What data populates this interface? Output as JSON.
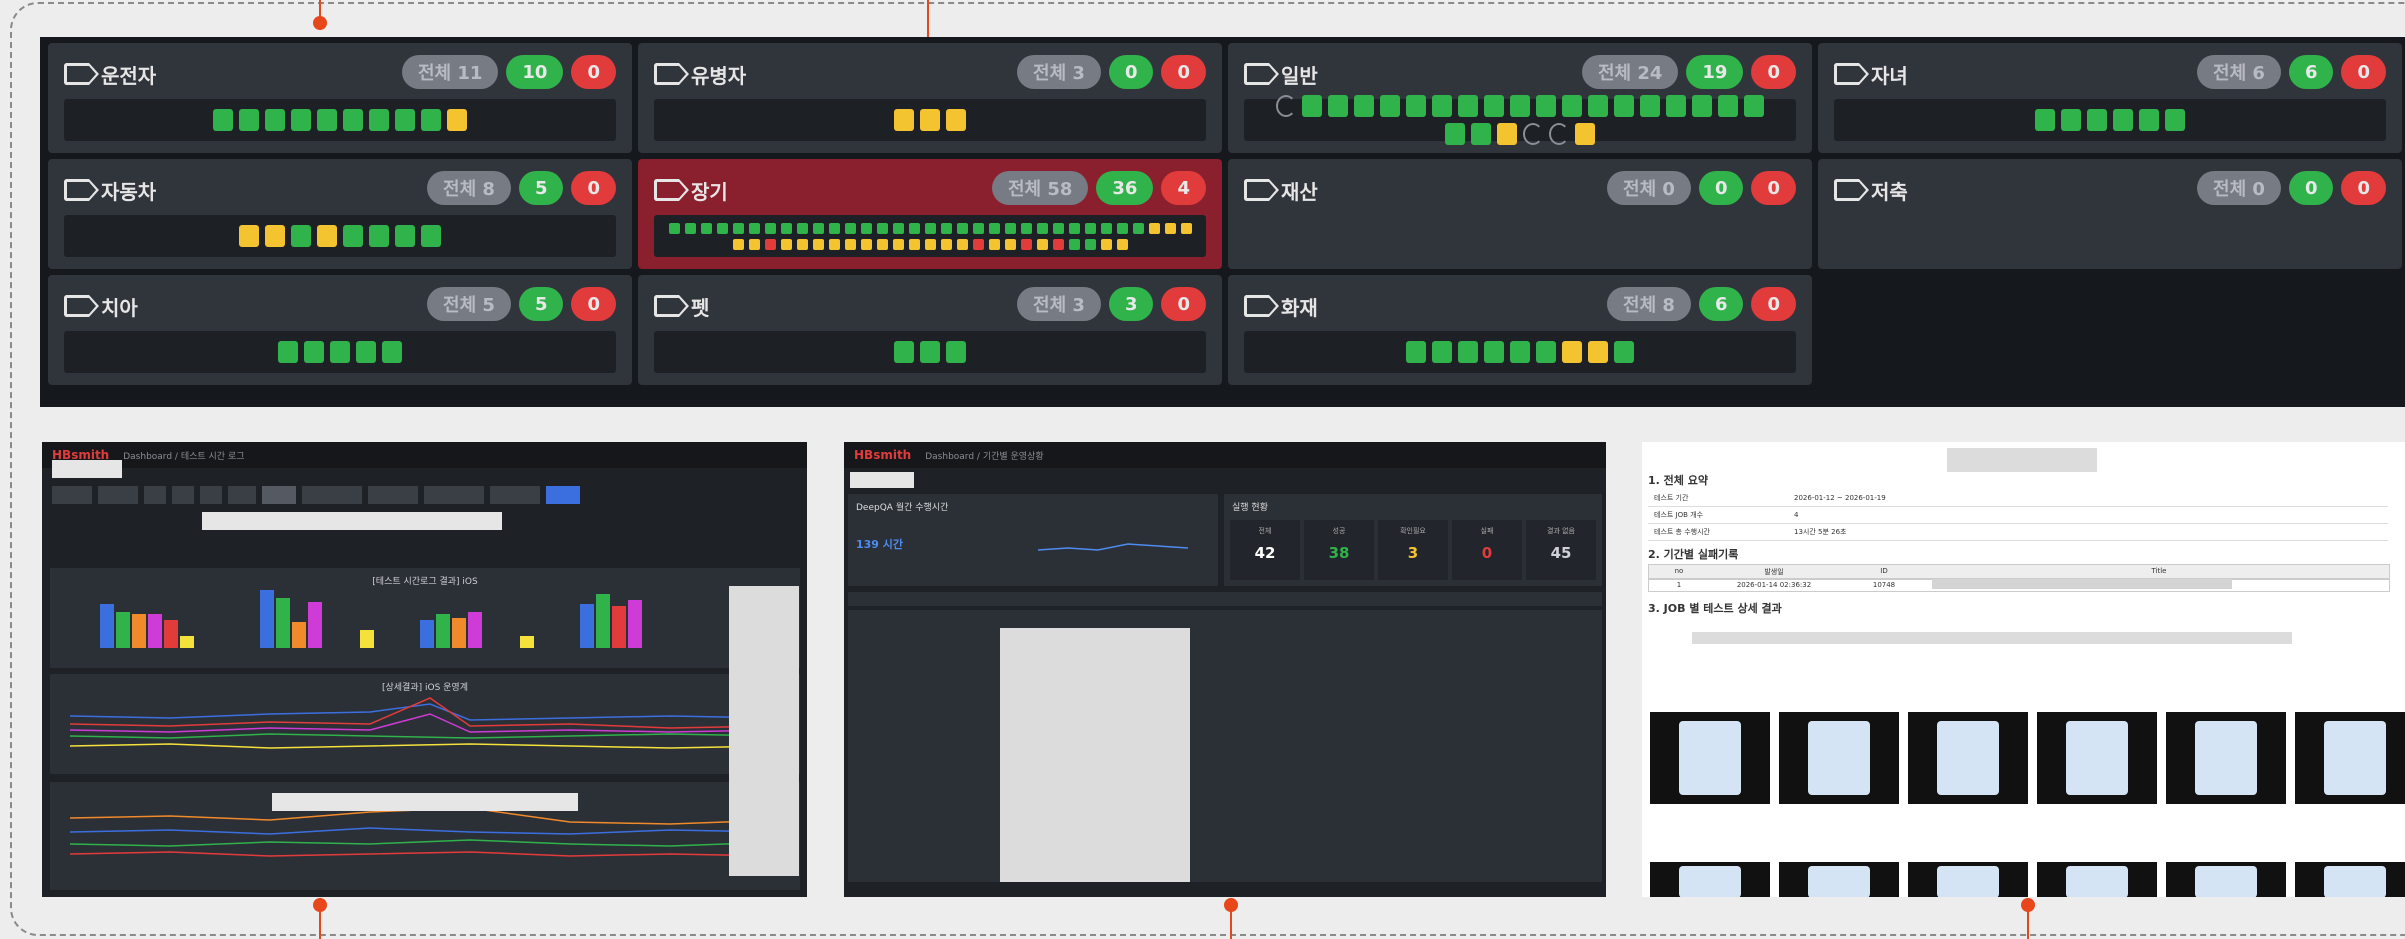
{
  "cards": [
    {
      "name": "운전자",
      "total": "전체 11",
      "pass": "10",
      "fail": "0",
      "red": false,
      "squares": [
        "g",
        "g",
        "g",
        "g",
        "g",
        "g",
        "g",
        "g",
        "g",
        "y"
      ]
    },
    {
      "name": "유병자",
      "total": "전체 3",
      "pass": "0",
      "fail": "0",
      "red": false,
      "squares": [
        "y",
        "y",
        "y"
      ]
    },
    {
      "name": "일반",
      "total": "전체 24",
      "pass": "19",
      "fail": "0",
      "red": false,
      "squares": [
        "o",
        "g",
        "g",
        "g",
        "g",
        "g",
        "g",
        "g",
        "g",
        "g",
        "g",
        "g",
        "g",
        "g",
        "g",
        "g",
        "g",
        "g",
        "g",
        "g",
        "g",
        "y",
        "o",
        "o",
        "y"
      ]
    },
    {
      "name": "자녀",
      "total": "전체 6",
      "pass": "6",
      "fail": "0",
      "red": false,
      "squares": [
        "g",
        "g",
        "g",
        "g",
        "g",
        "g"
      ]
    },
    {
      "name": "자동차",
      "total": "전체 8",
      "pass": "5",
      "fail": "0",
      "red": false,
      "squares": [
        "y",
        "y",
        "g",
        "y",
        "g",
        "g",
        "g",
        "g"
      ]
    },
    {
      "name": "장기",
      "total": "전체 58",
      "pass": "36",
      "fail": "4",
      "red": true,
      "squares": [
        "g",
        "g",
        "g",
        "g",
        "g",
        "g",
        "g",
        "g",
        "g",
        "g",
        "g",
        "g",
        "g",
        "g",
        "g",
        "g",
        "g",
        "g",
        "g",
        "g",
        "g",
        "g",
        "g",
        "g",
        "g",
        "g",
        "g",
        "g",
        "g",
        "g",
        "y",
        "y",
        "y",
        "y",
        "y",
        "r",
        "y",
        "y",
        "y",
        "y",
        "y",
        "y",
        "y",
        "y",
        "y",
        "y",
        "y",
        "y",
        "r",
        "y",
        "y",
        "r",
        "y",
        "r",
        "g",
        "g",
        "y",
        "y"
      ]
    },
    {
      "name": "재산",
      "total": "전체 0",
      "pass": "0",
      "fail": "0",
      "red": false,
      "squares": []
    },
    {
      "name": "저축",
      "total": "전체 0",
      "pass": "0",
      "fail": "0",
      "red": false,
      "squares": []
    },
    {
      "name": "치아",
      "total": "전체 5",
      "pass": "5",
      "fail": "0",
      "red": false,
      "squares": [
        "g",
        "g",
        "g",
        "g",
        "g"
      ]
    },
    {
      "name": "펫",
      "total": "전체 3",
      "pass": "3",
      "fail": "0",
      "red": false,
      "squares": [
        "g",
        "g",
        "g"
      ]
    },
    {
      "name": "화재",
      "total": "전체 8",
      "pass": "6",
      "fail": "0",
      "red": false,
      "squares": [
        "g",
        "g",
        "g",
        "g",
        "g",
        "g",
        "y",
        "y",
        "g"
      ]
    }
  ],
  "shot1": {
    "logo": "HBsmith",
    "crumb": "Dashboard / 테스트 시간 로그",
    "chart1_title": "[테스트 시간로그 결과] iOS",
    "chart2_title": "[상세결과] iOS 운영계"
  },
  "shot2": {
    "logo": "HBsmith",
    "crumb": "Dashboard / 기간별 운영상황",
    "panel1_title": "DeepQA 월간 수행시간",
    "panel1_value": "139 시간",
    "panel2_title": "실행 현황",
    "stats": [
      {
        "label": "전체",
        "value": "42"
      },
      {
        "label": "성공",
        "value": "38"
      },
      {
        "label": "확인필요",
        "value": "3"
      },
      {
        "label": "실패",
        "value": "0"
      },
      {
        "label": "결과 없음",
        "value": "45"
      }
    ]
  },
  "shot3": {
    "s1": "1. 전체 요약",
    "s2": "2. 기간별 실패기록",
    "s3": "3. JOB 별 테스트 상세 결과",
    "rows": [
      {
        "k": "테스트 기간",
        "v": "2026-01-12 ~ 2026-01-19"
      },
      {
        "k": "테스트 JOB 개수",
        "v": "4"
      },
      {
        "k": "테스트 총 수행시간",
        "v": "13시간 5분 26초"
      }
    ],
    "fail_header": [
      "no",
      "발생일",
      "ID",
      "Title"
    ],
    "fail_row": [
      "1",
      "2026-01-14 02:36:32",
      "10748",
      ""
    ]
  },
  "colors": {
    "green": "#2fb34a",
    "yellow": "#f4c430",
    "red": "#e23b3b",
    "accent": "#e8471c"
  }
}
